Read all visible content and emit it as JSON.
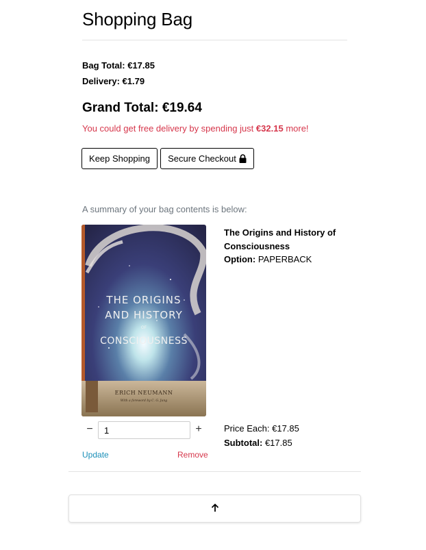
{
  "page": {
    "title": "Shopping Bag"
  },
  "totals": {
    "bag_total_label": "Bag Total:",
    "bag_total_value": "€17.85",
    "delivery_label": "Delivery:",
    "delivery_value": "€1.79",
    "grand_total_label": "Grand Total:",
    "grand_total_value": "€19.64",
    "free_delivery_prefix": "You could get free delivery by spending just",
    "free_delivery_amount": "€32.15",
    "free_delivery_suffix": "more!"
  },
  "actions": {
    "keep_shopping": "Keep Shopping",
    "secure_checkout": "Secure Checkout",
    "secure_checkout_icon": "lock-icon"
  },
  "summary": {
    "note": "A summary of your bag contents is below:"
  },
  "items": [
    {
      "title": "The Origins and History of Consciousness",
      "option_label": "Option:",
      "option_value": "PAPERBACK",
      "cover": {
        "title_lines": [
          "THE ORIGINS",
          "AND HISTORY",
          "OF",
          "CONSCIOUSNESS"
        ],
        "author": "ERICH NEUMANN",
        "foreword": "With a foreword by C. G. Jung"
      },
      "quantity": "1",
      "minus_symbol": "−",
      "plus_symbol": "+",
      "update_label": "Update",
      "remove_label": "Remove",
      "price_each_label": "Price Each:",
      "price_each_value": "€17.85",
      "subtotal_label": "Subtotal:",
      "subtotal_value": "€17.85"
    }
  ],
  "footer": {
    "back_to_top_icon": "arrow-up-icon"
  },
  "colors": {
    "alert_red": "#d6364b",
    "link_blue": "#1a8fb8",
    "muted_gray": "#6c757d"
  }
}
